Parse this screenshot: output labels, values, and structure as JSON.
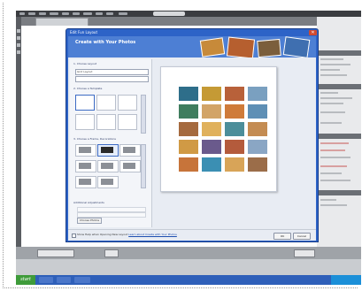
{
  "dialog": {
    "title": "Edit Fun Layout",
    "heading": "Create with Your Photos",
    "sections": {
      "choose_layout": "1. Choose Layout",
      "choose_template": "2. Choose a Template",
      "choose_style": "3. Choose a Frame, Decorations",
      "additional": "Additional Adjustments"
    },
    "layout_value": "Grid Layout",
    "preset_button": "Choose Photos",
    "footer_checkbox_label": "Show Help when Opening New Layout",
    "footer_link": "Learn about Create with Your Photos",
    "ok_label": "OK",
    "cancel_label": "Cancel"
  },
  "taskbar": {
    "start_label": "start"
  },
  "photo_grid": {
    "columns": 4,
    "rows": 5,
    "colors": [
      "#2e6e8a",
      "#c59a35",
      "#b8613a",
      "#7aa0c0",
      "#3f7d5e",
      "#d2a467",
      "#cf7b3a",
      "#5e8fb5",
      "#a56a3e",
      "#e0b15c",
      "#4c8e9a",
      "#c48c52",
      "#d09a45",
      "#6a5a8c",
      "#b45b3c",
      "#8aa6c4",
      "#c7743a",
      "#3b8fb3",
      "#d8a458",
      "#9b6d49"
    ]
  },
  "colors": {
    "dialog_blue": "#2d63c7",
    "taskbar_blue": "#2e5fb9",
    "start_green": "#3e9b3a",
    "close_red": "#d24a2e"
  }
}
